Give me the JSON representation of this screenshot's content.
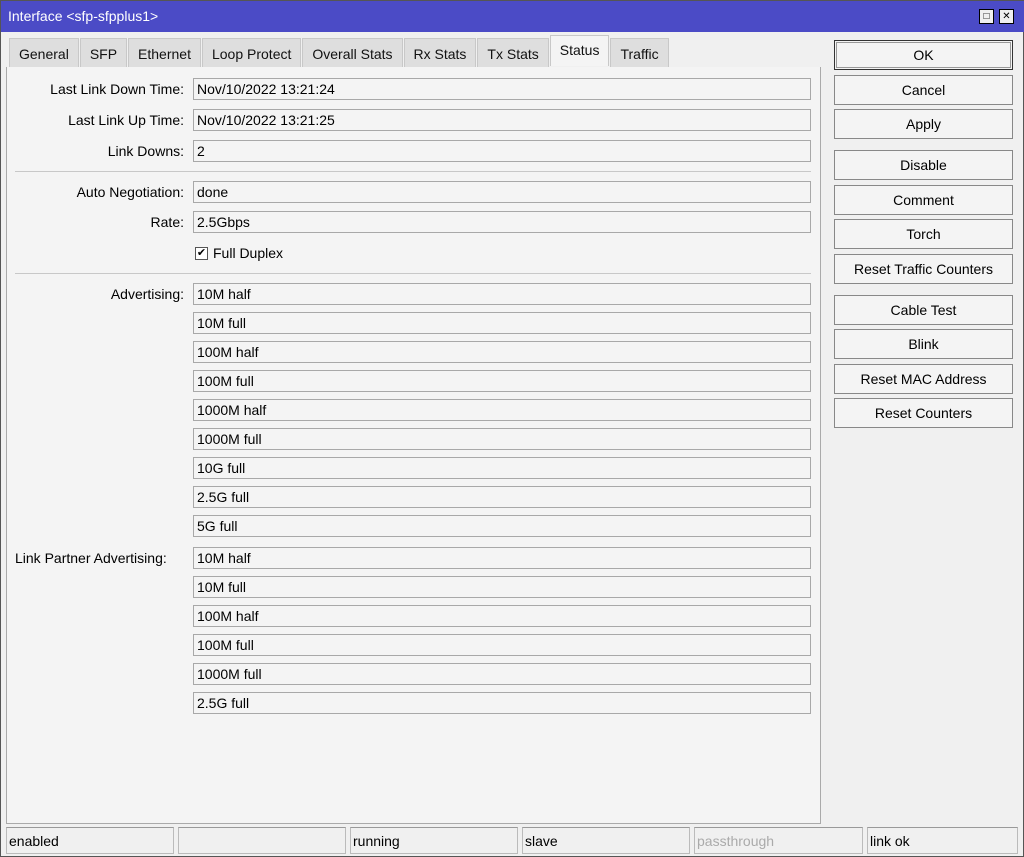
{
  "window": {
    "title": "Interface <sfp-sfpplus1>"
  },
  "tabs": [
    "General",
    "SFP",
    "Ethernet",
    "Loop Protect",
    "Overall Stats",
    "Rx Stats",
    "Tx Stats",
    "Status",
    "Traffic"
  ],
  "active_tab": "Status",
  "fields": {
    "last_link_down_label": "Last Link Down Time:",
    "last_link_down": "Nov/10/2022 13:21:24",
    "last_link_up_label": "Last Link Up Time:",
    "last_link_up": "Nov/10/2022 13:21:25",
    "link_downs_label": "Link Downs:",
    "link_downs": "2",
    "auto_neg_label": "Auto Negotiation:",
    "auto_neg": "done",
    "rate_label": "Rate:",
    "rate": "2.5Gbps",
    "full_duplex_label": "Full Duplex",
    "full_duplex": true,
    "advertising_label": "Advertising:",
    "advertising": [
      "10M half",
      "10M full",
      "100M half",
      "100M full",
      "1000M half",
      "1000M full",
      "10G full",
      "2.5G full",
      "5G full"
    ],
    "lpa_label": "Link Partner Advertising:",
    "lpa": [
      "10M half",
      "10M full",
      "100M half",
      "100M full",
      "1000M full",
      "2.5G full"
    ]
  },
  "buttons": {
    "ok": "OK",
    "cancel": "Cancel",
    "apply": "Apply",
    "disable": "Disable",
    "comment": "Comment",
    "torch": "Torch",
    "reset_traffic": "Reset Traffic Counters",
    "cable_test": "Cable Test",
    "blink": "Blink",
    "reset_mac": "Reset MAC Address",
    "reset_counters": "Reset Counters"
  },
  "status_bar": [
    "enabled",
    "",
    "running",
    "slave",
    "passthrough",
    "link ok"
  ]
}
